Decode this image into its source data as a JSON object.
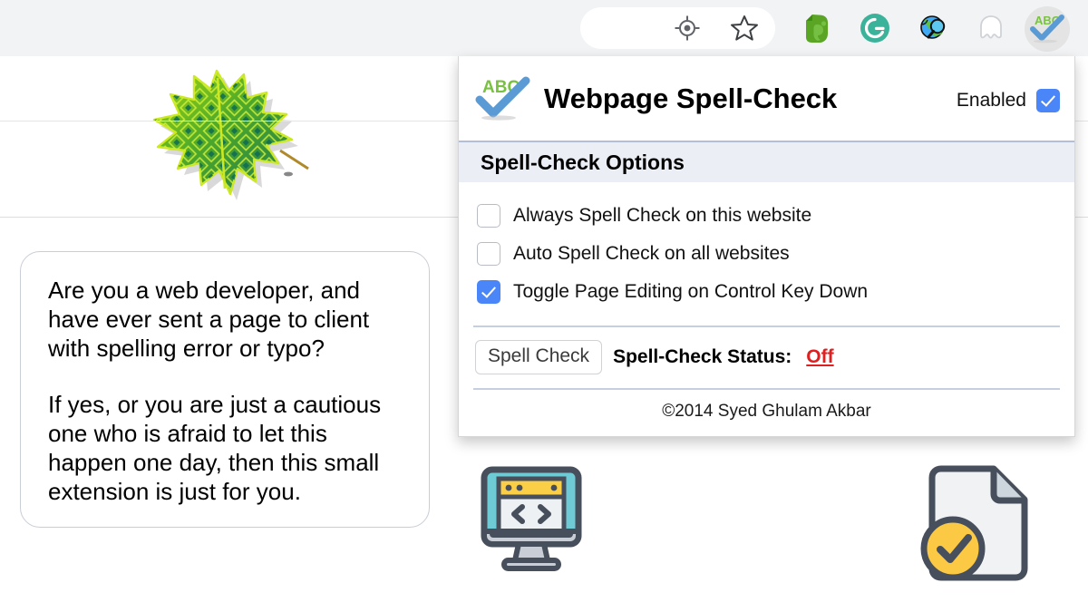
{
  "browser": {
    "toolbar_icons": [
      {
        "name": "location-target-icon",
        "label": "Location"
      },
      {
        "name": "bookmark-star-icon",
        "label": "Bookmark this page"
      },
      {
        "name": "evernote-icon",
        "label": "Evernote Web Clipper"
      },
      {
        "name": "grammarly-icon",
        "label": "Grammarly"
      },
      {
        "name": "globe-search-icon",
        "label": "Web Search"
      },
      {
        "name": "ghost-icon",
        "label": "Ghostery"
      },
      {
        "name": "webpage-spell-check-icon",
        "label": "Webpage Spell-Check"
      }
    ]
  },
  "page": {
    "leaf_image_alt": "circuit-pattern green leaf",
    "intro": {
      "paragraph1": "Are you a web developer, and have ever sent a page to client with spelling error or typo?",
      "paragraph2": "If yes, or you are just a cautious one who is afraid to let this happen one day, then this small extension is just for you."
    },
    "feature_icons": [
      {
        "name": "code-monitor-icon",
        "label": "Web page code"
      },
      {
        "name": "document-check-icon",
        "label": "Checked document"
      }
    ]
  },
  "popup": {
    "logo_text": "ABC",
    "title": "Webpage Spell-Check",
    "enabled_label": "Enabled",
    "enabled_checked": true,
    "options_header": "Spell-Check Options",
    "options": [
      {
        "label": "Always Spell Check on this website",
        "checked": false
      },
      {
        "label": "Auto Spell Check on all websites",
        "checked": false
      },
      {
        "label": "Toggle Page Editing on Control Key Down",
        "checked": true
      }
    ],
    "spell_check_button": "Spell Check",
    "status_label": "Spell-Check Status:",
    "status_value": "Off",
    "copyright": "©2014 Syed Ghulam Akbar"
  },
  "colors": {
    "toolbar_bg": "#f1f3f4",
    "accent_blue": "#4a86f7",
    "options_header_bg": "#eceef6",
    "options_header_rule": "#b3bfd8",
    "status_off": "#e02020",
    "logo_green": "#7ac143",
    "logo_blue": "#5b9bd5"
  }
}
